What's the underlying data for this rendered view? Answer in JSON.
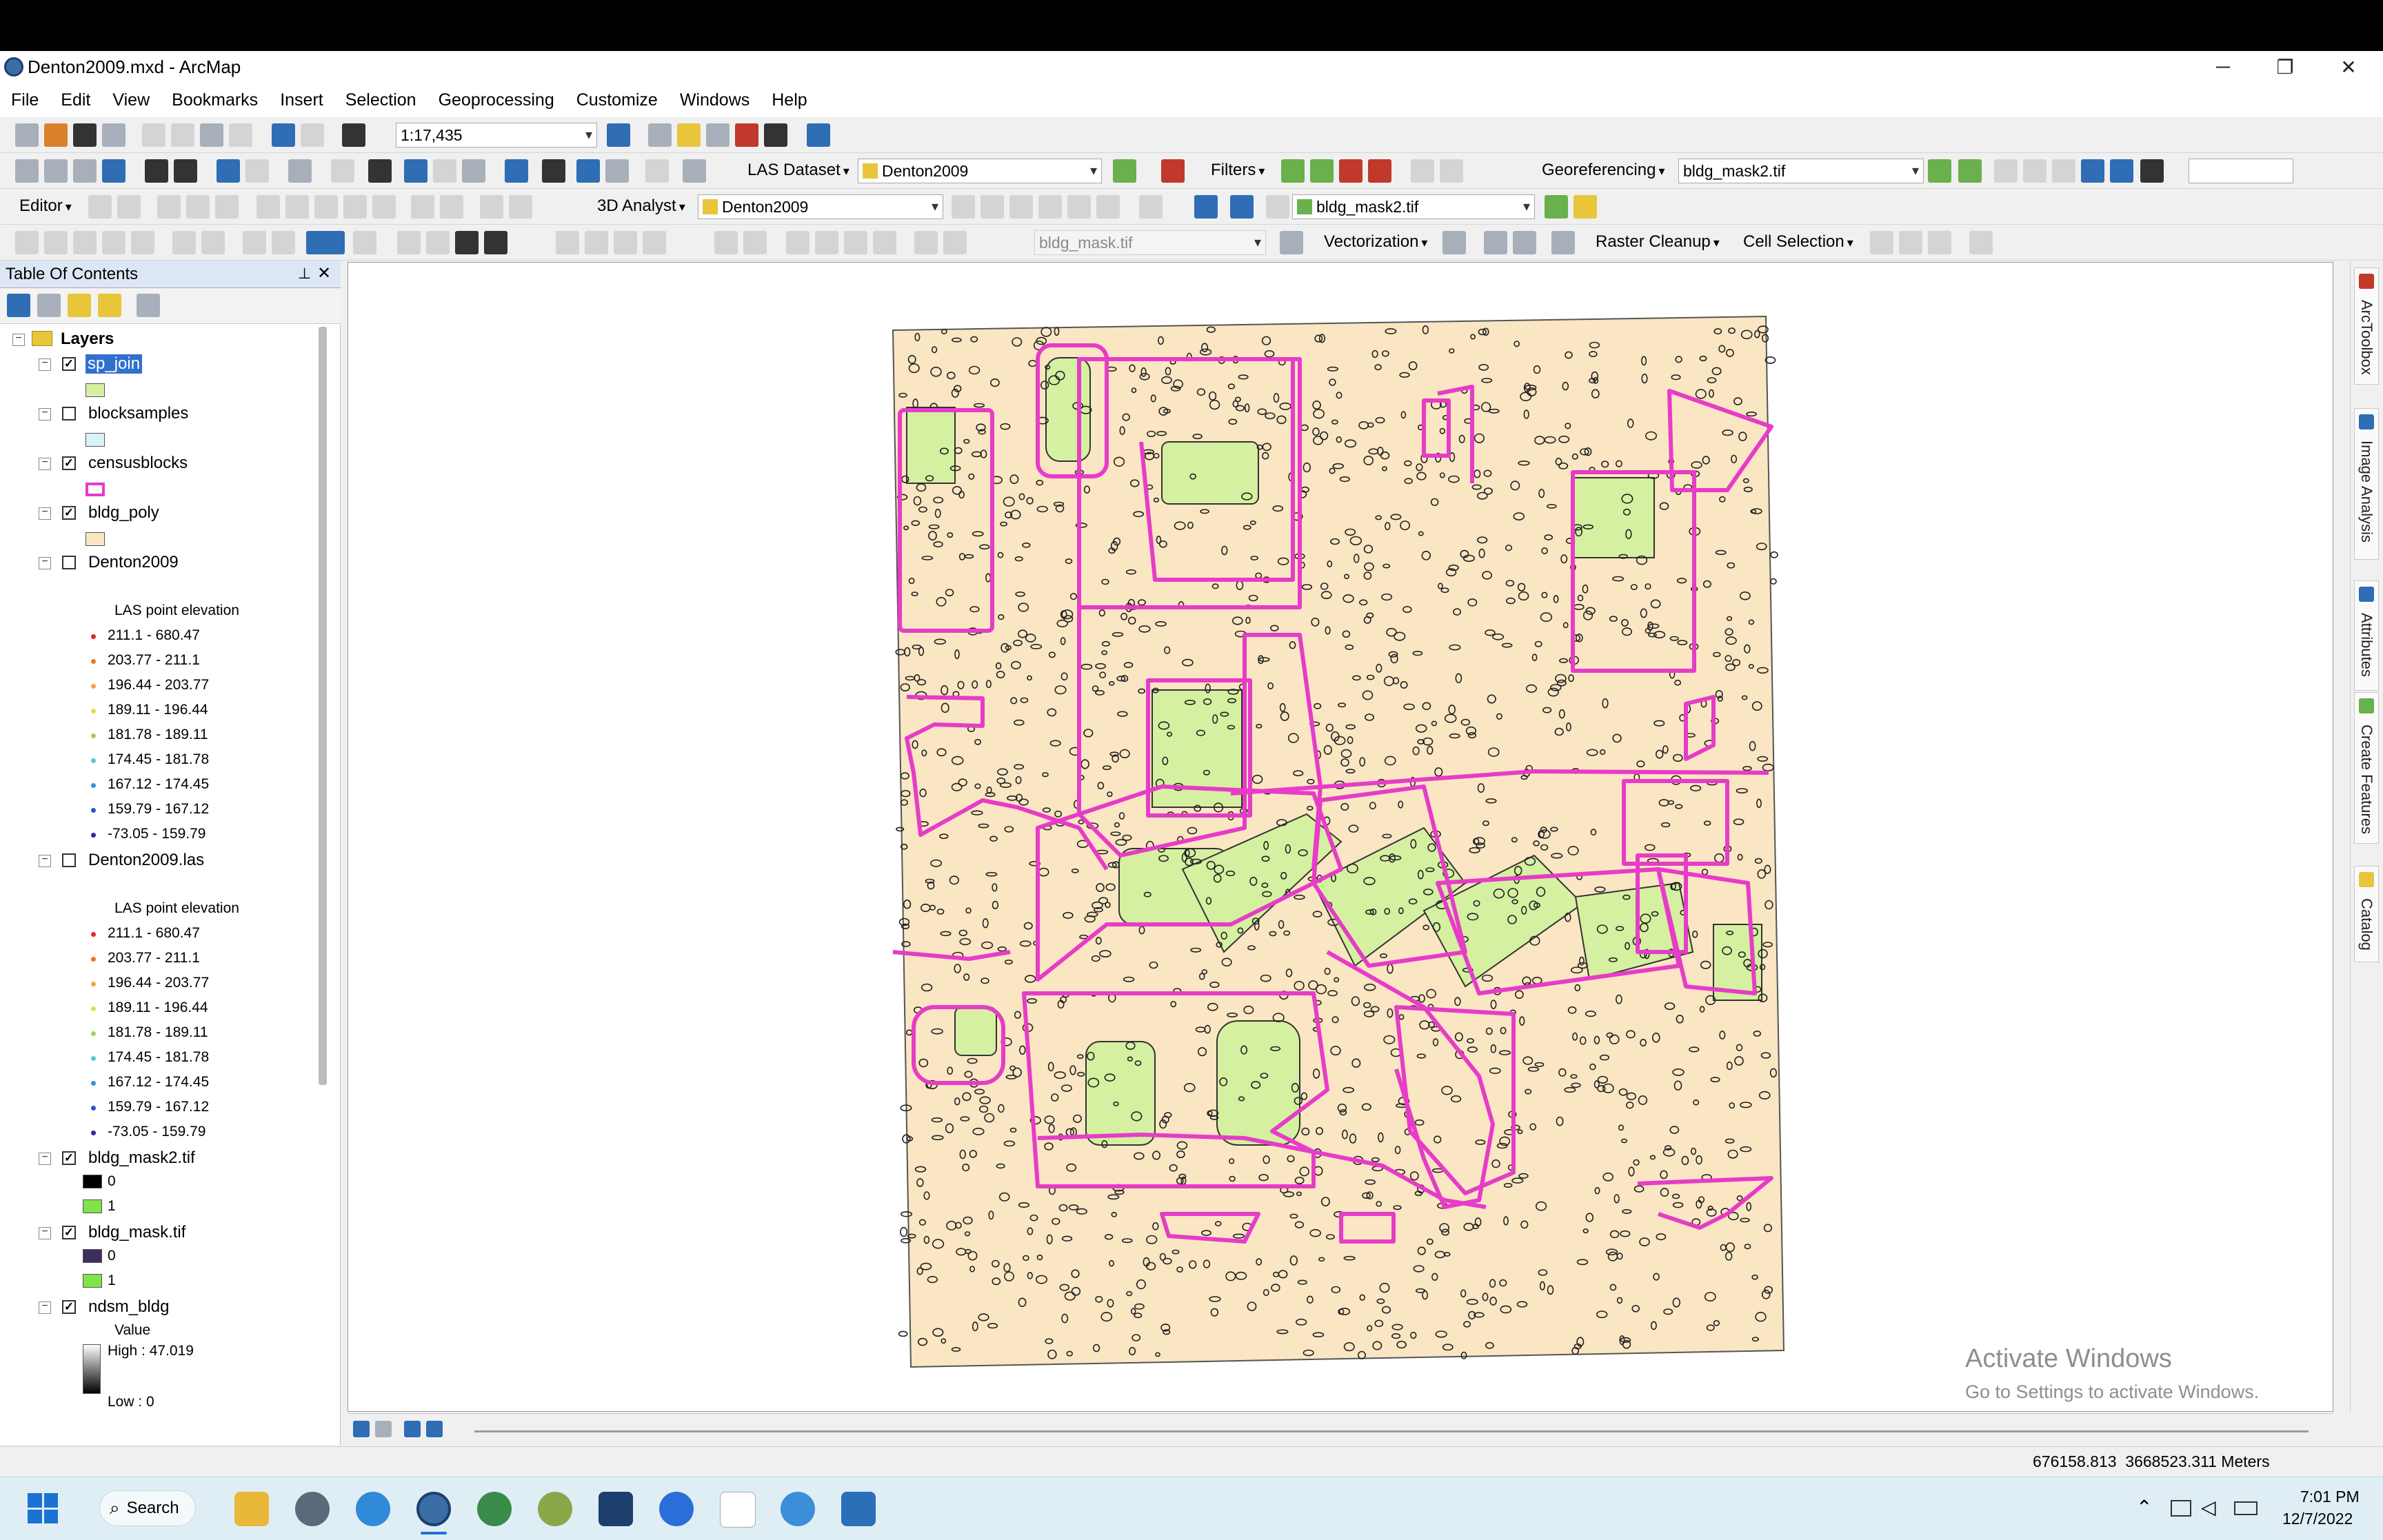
{
  "window": {
    "title": "Denton2009.mxd - ArcMap",
    "minimize": "─",
    "maximize": "❐",
    "close": "✕"
  },
  "menu": [
    "File",
    "Edit",
    "View",
    "Bookmarks",
    "Insert",
    "Selection",
    "Geoprocessing",
    "Customize",
    "Windows",
    "Help"
  ],
  "toolbars": {
    "scale": "1:17,435",
    "las_dataset": "LAS Dataset",
    "las_layer": "Denton2009",
    "filters": "Filters",
    "georeferencing": "Georeferencing",
    "georef_layer": "bldg_mask2.tif",
    "editor": "Editor",
    "analyst_3d": "3D Analyst",
    "analyst_layer": "Denton2009",
    "raster_layer": "bldg_mask2.tif",
    "scan_layer": "bldg_mask.tif",
    "vectorization": "Vectorization",
    "raster_cleanup": "Raster Cleanup",
    "cell_selection": "Cell Selection"
  },
  "toc": {
    "title": "Table Of Contents",
    "pin_icon": "pin-icon",
    "close_icon": "close-icon",
    "root": "Layers",
    "layers": {
      "sp_join": "sp_join",
      "blocksamples": "blocksamples",
      "censusblocks": "censusblocks",
      "bldg_poly": "bldg_poly",
      "denton2009": "Denton2009",
      "denton2009_las": "Denton2009.las",
      "bldg_mask2": "bldg_mask2.tif",
      "bldg_mask": "bldg_mask.tif",
      "ndsm_bldg": "ndsm_bldg"
    },
    "las_heading": "LAS point elevation",
    "las_classes": [
      {
        "label": "211.1 - 680.47",
        "color": "#e8251f"
      },
      {
        "label": "203.77 - 211.1",
        "color": "#f0712a"
      },
      {
        "label": "196.44 - 203.77",
        "color": "#f4a63a"
      },
      {
        "label": "189.11 - 196.44",
        "color": "#e6dc4a"
      },
      {
        "label": "181.78 - 189.11",
        "color": "#9bd45c"
      },
      {
        "label": "174.45 - 181.78",
        "color": "#5cc8c8"
      },
      {
        "label": "167.12 - 174.45",
        "color": "#3a8fd8"
      },
      {
        "label": "159.79 - 167.12",
        "color": "#2a55c8"
      },
      {
        "label": "-73.05 - 159.79",
        "color": "#2a2a9a"
      }
    ],
    "mask2_values": [
      "0",
      "1"
    ],
    "mask_values": [
      "0",
      "1"
    ],
    "ndsm_value_label": "Value",
    "ndsm_high": "High : 47.019",
    "ndsm_low": "Low : 0"
  },
  "dock": [
    "ArcToolbox",
    "Image Analysis",
    "Attributes",
    "Create Features",
    "Catalog"
  ],
  "watermark": {
    "line1": "Activate Windows",
    "line2": "Go to Settings to activate Windows."
  },
  "status": {
    "coords": "676158.813  3668523.311 Meters"
  },
  "taskbar": {
    "search": "Search",
    "time": "7:01 PM",
    "date": "12/7/2022"
  },
  "colors": {
    "census_outline": "#e63cc8",
    "building_fill": "#fae6c2",
    "selected_fill": "#d5f0a0",
    "mask_on": "#7fe34a",
    "mask_off_dark": "#3d2c5c"
  }
}
